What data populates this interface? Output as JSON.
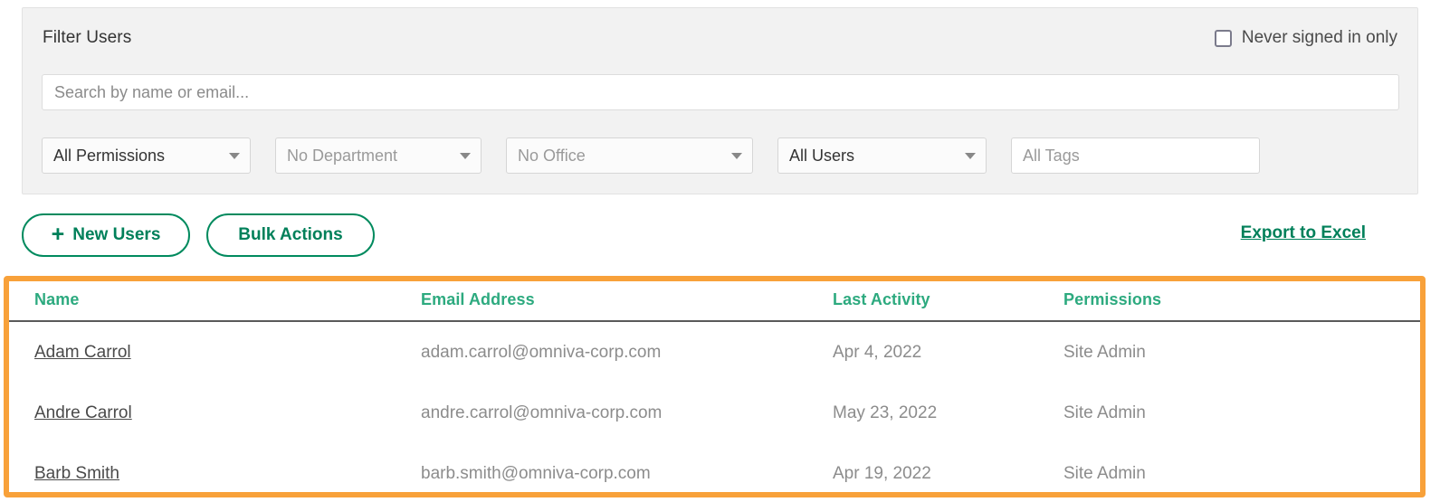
{
  "filter_panel": {
    "title": "Filter Users",
    "never_signed_in": {
      "label": "Never signed in only",
      "checked": false,
      "icon": "checkbox-unchecked-icon"
    },
    "search": {
      "value": "",
      "placeholder": "Search by name or email..."
    },
    "selects": [
      {
        "name": "permissions",
        "value": "All Permissions",
        "state": "selected",
        "icon": "chevron-down-icon"
      },
      {
        "name": "department",
        "value": "No Department",
        "state": "placeholder",
        "icon": "chevron-down-icon"
      },
      {
        "name": "office",
        "value": "No Office",
        "state": "placeholder",
        "icon": "chevron-down-icon"
      },
      {
        "name": "users",
        "value": "All Users",
        "state": "selected",
        "icon": "chevron-down-icon"
      }
    ],
    "tags": {
      "value": "",
      "placeholder": "All Tags"
    }
  },
  "actions": {
    "new_users_label": "New Users",
    "new_users_icon": "plus-icon",
    "bulk_actions_label": "Bulk Actions",
    "export_label": "Export to Excel"
  },
  "table": {
    "headers": {
      "name": "Name",
      "email": "Email Address",
      "last_activity": "Last Activity",
      "permissions": "Permissions"
    },
    "rows": [
      {
        "name": "Adam Carrol",
        "email": "adam.carrol@omniva-corp.com",
        "last_activity": "Apr 4, 2022",
        "permissions": "Site Admin"
      },
      {
        "name": "Andre Carrol",
        "email": "andre.carrol@omniva-corp.com",
        "last_activity": "May 23, 2022",
        "permissions": "Site Admin"
      },
      {
        "name": "Barb Smith",
        "email": "barb.smith@omniva-corp.com",
        "last_activity": "Apr 19, 2022",
        "permissions": "Site Admin"
      }
    ]
  },
  "colors": {
    "highlight_orange": "#f8a13a",
    "header_green": "#2daa7f",
    "button_green": "#00805a",
    "panel_gray": "#f2f2f2"
  }
}
